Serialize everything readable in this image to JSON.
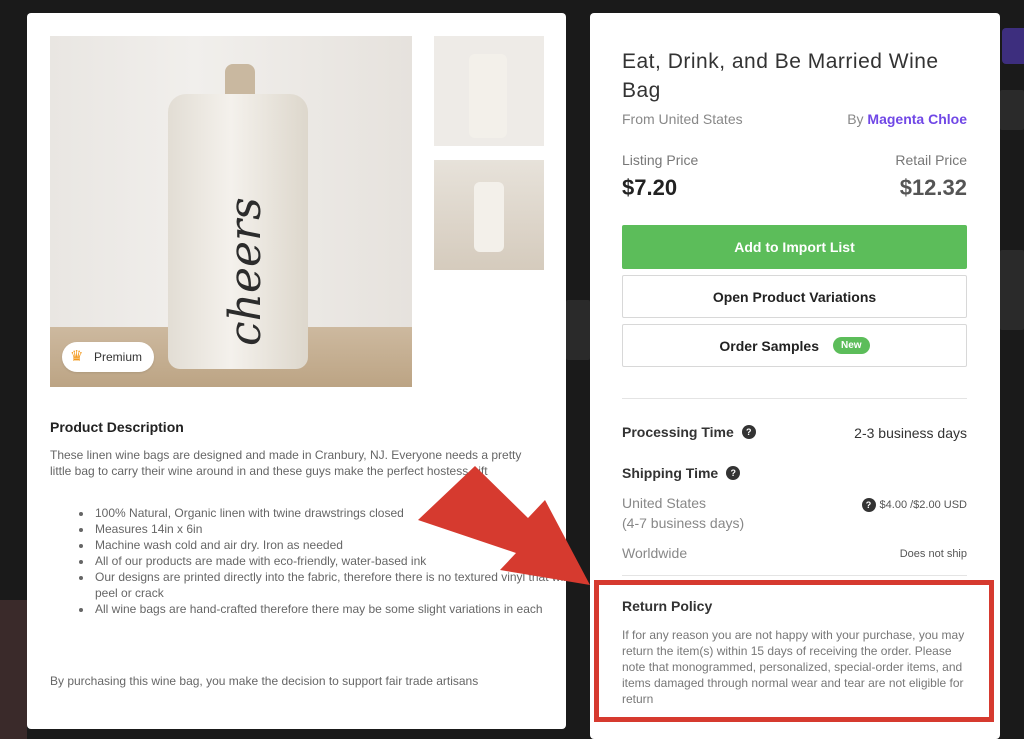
{
  "left": {
    "badge_label": "Premium",
    "description": {
      "title": "Product Description",
      "intro": "These linen wine bags are designed and made in Cranbury, NJ. Everyone needs a pretty little bag to carry their wine around in and these guys make the perfect hostess gift",
      "bullets": [
        "100% Natural, Organic linen with twine drawstrings closed",
        "Measures 14in x 6in",
        "Machine wash cold and air dry. Iron as needed",
        "All of our products are made with eco-friendly, water-based ink",
        "Our designs are printed directly into the fabric, therefore there is no textured vinyl that will peel or crack",
        "All wine bags are hand-crafted therefore there may be some slight variations in each"
      ],
      "footer": "By purchasing this wine bag, you make the decision to support fair trade artisans"
    },
    "image_script": "cheers"
  },
  "right": {
    "title": "Eat, Drink, and Be Married Wine Bag",
    "origin": "From United States",
    "by_prefix": "By",
    "vendor": "Magenta Chloe",
    "listing_price_label": "Listing Price",
    "listing_price": "$7.20",
    "retail_price_label": "Retail Price",
    "retail_price": "$12.32",
    "add_button": "Add to Import List",
    "variations_button": "Open Product Variations",
    "samples_button": "Order Samples",
    "new_badge": "New",
    "processing_label": "Processing Time",
    "processing_value": "2-3 business days",
    "shipping_label": "Shipping Time",
    "shipping": [
      {
        "dest": "United States",
        "sub": "(4-7 business days)",
        "price": "$4.00 /$2.00 USD"
      },
      {
        "dest": "Worldwide",
        "sub": "",
        "price": "Does not ship"
      }
    ],
    "return_title": "Return Policy",
    "return_text": "If for any reason you are not happy with your purchase, you may return the item(s) within 15 days of receiving the order. Please note that monogrammed, personalized, special-order items, and items damaged through normal wear and tear are not eligible for return"
  },
  "colors": {
    "accent_green": "#5cbd5a",
    "vendor_purple": "#7047e6",
    "annotation_red": "#d63a2f"
  },
  "icons": {
    "premium": "crown-icon",
    "help": "question-circle-icon"
  }
}
